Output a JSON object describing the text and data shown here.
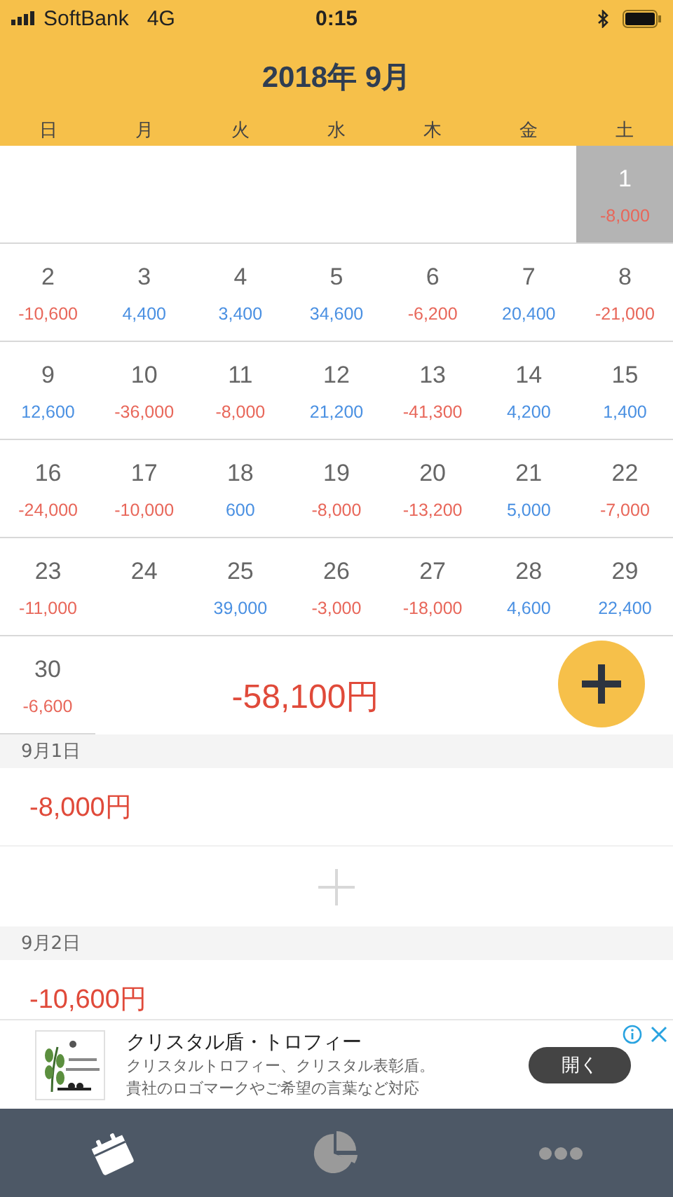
{
  "status_bar": {
    "carrier": "SoftBank",
    "network": "4G",
    "time": "0:15"
  },
  "header": {
    "title": "2018年 9月"
  },
  "weekdays": [
    "日",
    "月",
    "火",
    "水",
    "木",
    "金",
    "土"
  ],
  "weeks": [
    [
      {
        "kind": "blank"
      },
      {
        "kind": "blank"
      },
      {
        "kind": "blank"
      },
      {
        "kind": "blank"
      },
      {
        "kind": "blank"
      },
      {
        "kind": "blank"
      },
      {
        "kind": "day",
        "day": "1",
        "amount": "-8,000",
        "color": "#e8675a",
        "selected": true
      }
    ],
    [
      {
        "kind": "day",
        "day": "2",
        "amount": "-10,600",
        "color": "#e8675a",
        "selected": false
      },
      {
        "kind": "day",
        "day": "3",
        "amount": "4,400",
        "color": "#4a90e2",
        "selected": false
      },
      {
        "kind": "day",
        "day": "4",
        "amount": "3,400",
        "color": "#4a90e2",
        "selected": false
      },
      {
        "kind": "day",
        "day": "5",
        "amount": "34,600",
        "color": "#4a90e2",
        "selected": false
      },
      {
        "kind": "day",
        "day": "6",
        "amount": "-6,200",
        "color": "#e8675a",
        "selected": false
      },
      {
        "kind": "day",
        "day": "7",
        "amount": "20,400",
        "color": "#4a90e2",
        "selected": false
      },
      {
        "kind": "day",
        "day": "8",
        "amount": "-21,000",
        "color": "#e8675a",
        "selected": false
      }
    ],
    [
      {
        "kind": "day",
        "day": "9",
        "amount": "12,600",
        "color": "#4a90e2",
        "selected": false
      },
      {
        "kind": "day",
        "day": "10",
        "amount": "-36,000",
        "color": "#e8675a",
        "selected": false
      },
      {
        "kind": "day",
        "day": "11",
        "amount": "-8,000",
        "color": "#e8675a",
        "selected": false
      },
      {
        "kind": "day",
        "day": "12",
        "amount": "21,200",
        "color": "#4a90e2",
        "selected": false
      },
      {
        "kind": "day",
        "day": "13",
        "amount": "-41,300",
        "color": "#e8675a",
        "selected": false
      },
      {
        "kind": "day",
        "day": "14",
        "amount": "4,200",
        "color": "#4a90e2",
        "selected": false
      },
      {
        "kind": "day",
        "day": "15",
        "amount": "1,400",
        "color": "#4a90e2",
        "selected": false
      }
    ],
    [
      {
        "kind": "day",
        "day": "16",
        "amount": "-24,000",
        "color": "#e8675a",
        "selected": false
      },
      {
        "kind": "day",
        "day": "17",
        "amount": "-10,000",
        "color": "#e8675a",
        "selected": false
      },
      {
        "kind": "day",
        "day": "18",
        "amount": "600",
        "color": "#4a90e2",
        "selected": false
      },
      {
        "kind": "day",
        "day": "19",
        "amount": "-8,000",
        "color": "#e8675a",
        "selected": false
      },
      {
        "kind": "day",
        "day": "20",
        "amount": "-13,200",
        "color": "#e8675a",
        "selected": false
      },
      {
        "kind": "day",
        "day": "21",
        "amount": "5,000",
        "color": "#4a90e2",
        "selected": false
      },
      {
        "kind": "day",
        "day": "22",
        "amount": "-7,000",
        "color": "#e8675a",
        "selected": false
      }
    ],
    [
      {
        "kind": "day",
        "day": "23",
        "amount": "-11,000",
        "color": "#e8675a",
        "selected": false
      },
      {
        "kind": "day",
        "day": "24",
        "selected": false
      },
      {
        "kind": "day",
        "day": "25",
        "amount": "39,000",
        "color": "#4a90e2",
        "selected": false
      },
      {
        "kind": "day",
        "day": "26",
        "amount": "-3,000",
        "color": "#e8675a",
        "selected": false
      },
      {
        "kind": "day",
        "day": "27",
        "amount": "-18,000",
        "color": "#e8675a",
        "selected": false
      },
      {
        "kind": "day",
        "day": "28",
        "amount": "4,600",
        "color": "#4a90e2",
        "selected": false
      },
      {
        "kind": "day",
        "day": "29",
        "amount": "22,400",
        "color": "#4a90e2",
        "selected": false
      }
    ]
  ],
  "last_day": {
    "day": "30",
    "amount": "-6,600",
    "color": "#e8675a",
    "selected": false
  },
  "month_total": "-58,100円",
  "entries": [
    {
      "date": "9月1日",
      "amount": "-8,000円",
      "add_row": true
    },
    {
      "date": "9月2日",
      "amount": "-10,600円",
      "add_row": false
    }
  ],
  "ad": {
    "title": "クリスタル盾・トロフィー",
    "line_1": "クリスタルトロフィー、クリスタル表彰盾。",
    "line_2": "貴社のロゴマークやご希望の言葉など対応",
    "button": "開く"
  },
  "tab_bar": [
    {
      "kind": "calendar",
      "selected": true
    },
    {
      "kind": "pie",
      "selected": false
    },
    {
      "kind": "more",
      "selected": false
    }
  ]
}
